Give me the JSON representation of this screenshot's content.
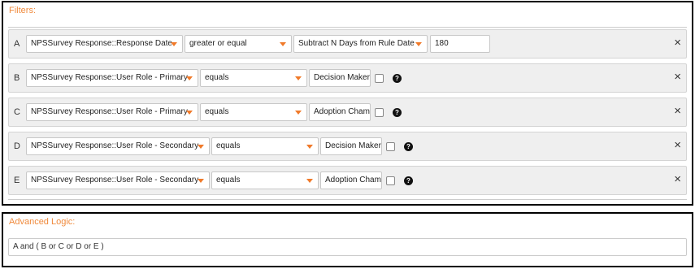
{
  "filters": {
    "title": "Filters:",
    "rows": [
      {
        "letter": "A",
        "field": "NPSSurvey Response::Response Date",
        "operator": "greater or equal",
        "mode": "Subtract N Days from Rule Date",
        "value": "180"
      },
      {
        "letter": "B",
        "field": "NPSSurvey Response::User Role - Primary",
        "operator": "equals",
        "value": "Decision Maker"
      },
      {
        "letter": "C",
        "field": "NPSSurvey Response::User Role - Primary",
        "operator": "equals",
        "value": "Adoption Champ"
      },
      {
        "letter": "D",
        "field": "NPSSurvey Response::User Role - Secondary",
        "operator": "equals",
        "value": "Decision Maker"
      },
      {
        "letter": "E",
        "field": "NPSSurvey Response::User Role - Secondary",
        "operator": "equals",
        "value": "Adoption Champ"
      }
    ],
    "close_icon": "×",
    "help_icon": "?"
  },
  "advanced_logic": {
    "title": "Advanced Logic:",
    "expression": "A and ( B or C or D or E )"
  },
  "colors": {
    "accent": "#f07a2a",
    "title": "#f08a3c"
  }
}
